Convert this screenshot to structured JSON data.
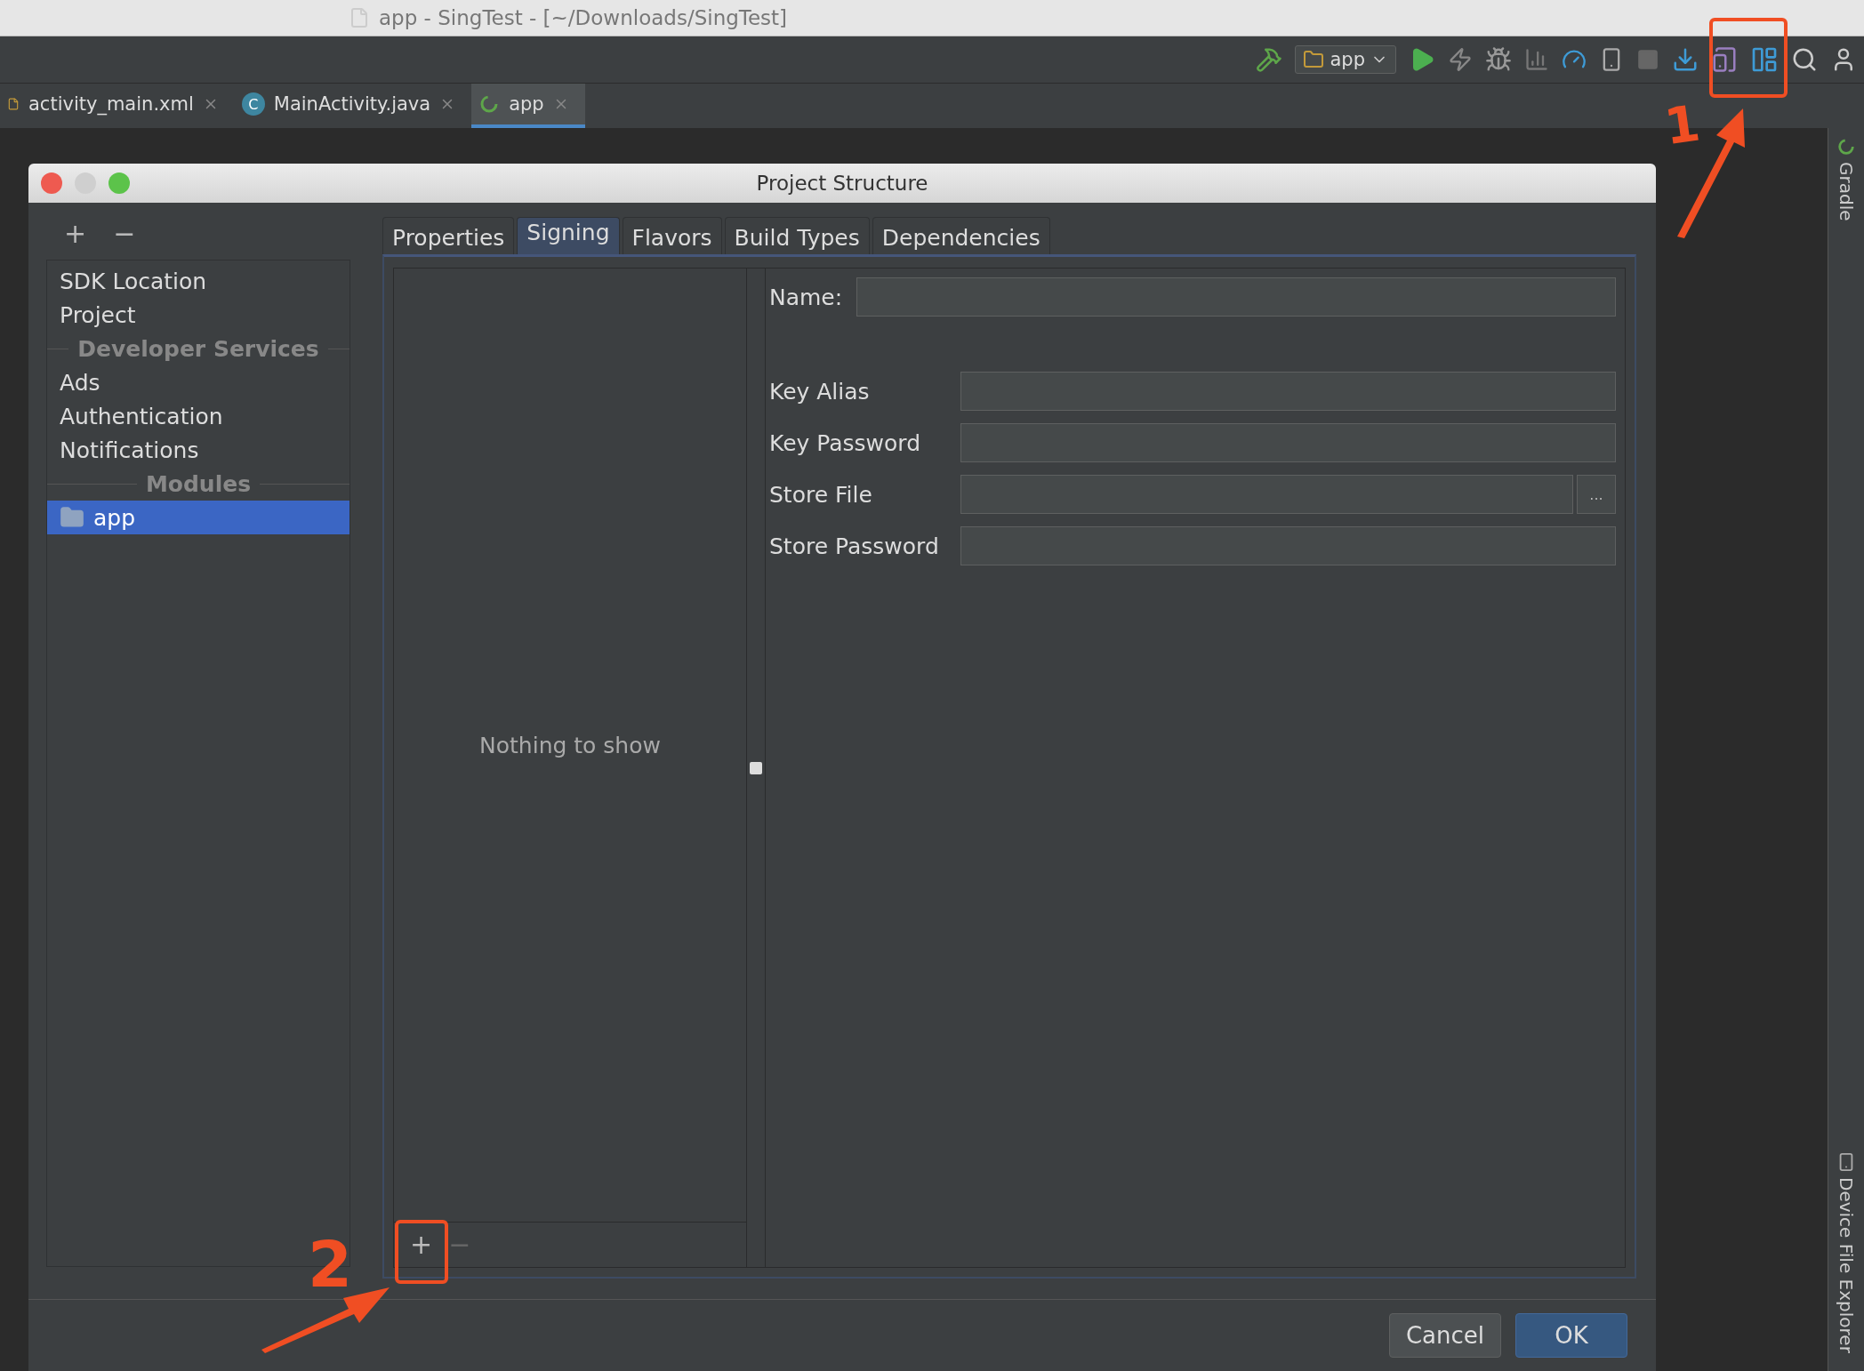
{
  "window": {
    "title": "app - SingTest - [~/Downloads/SingTest]"
  },
  "toolbar": {
    "run_config": "app"
  },
  "editor_tabs": [
    {
      "label": "activity_main.xml",
      "kind": "file",
      "selected": false
    },
    {
      "label": "MainActivity.java",
      "kind": "class",
      "badge": "C",
      "selected": false
    },
    {
      "label": "app",
      "kind": "gradle",
      "selected": true
    }
  ],
  "tool_windows": [
    {
      "label": "Gradle",
      "kind": "gradle"
    },
    {
      "label": "Device File Explorer",
      "kind": "device"
    }
  ],
  "dialog": {
    "title": "Project Structure",
    "sidebar": {
      "add": "+",
      "remove": "−",
      "items": [
        {
          "kind": "item",
          "label": "SDK Location",
          "selected": false
        },
        {
          "kind": "item",
          "label": "Project",
          "selected": false
        },
        {
          "kind": "header",
          "label": "Developer Services"
        },
        {
          "kind": "item",
          "label": "Ads",
          "selected": false
        },
        {
          "kind": "item",
          "label": "Authentication",
          "selected": false
        },
        {
          "kind": "item",
          "label": "Notifications",
          "selected": false
        },
        {
          "kind": "header",
          "label": "Modules"
        },
        {
          "kind": "module",
          "label": "app",
          "selected": true
        }
      ]
    },
    "tabs": [
      {
        "label": "Properties",
        "selected": false
      },
      {
        "label": "Signing",
        "selected": true
      },
      {
        "label": "Flavors",
        "selected": false
      },
      {
        "label": "Build Types",
        "selected": false
      },
      {
        "label": "Dependencies",
        "selected": false
      }
    ],
    "signing": {
      "empty_text": "Nothing to show",
      "add": "+",
      "remove": "−",
      "fields": [
        {
          "kind": "name",
          "label": "Name:"
        },
        {
          "kind": "text",
          "label": "Key Alias"
        },
        {
          "kind": "text",
          "label": "Key Password"
        },
        {
          "kind": "browse",
          "label": "Store File",
          "button": "..."
        },
        {
          "kind": "text",
          "label": "Store Password"
        }
      ]
    },
    "buttons": [
      {
        "label": "Cancel",
        "default": false
      },
      {
        "label": "OK",
        "default": true
      }
    ]
  },
  "annotations": [
    {
      "label": "1"
    },
    {
      "label": "2"
    }
  ]
}
